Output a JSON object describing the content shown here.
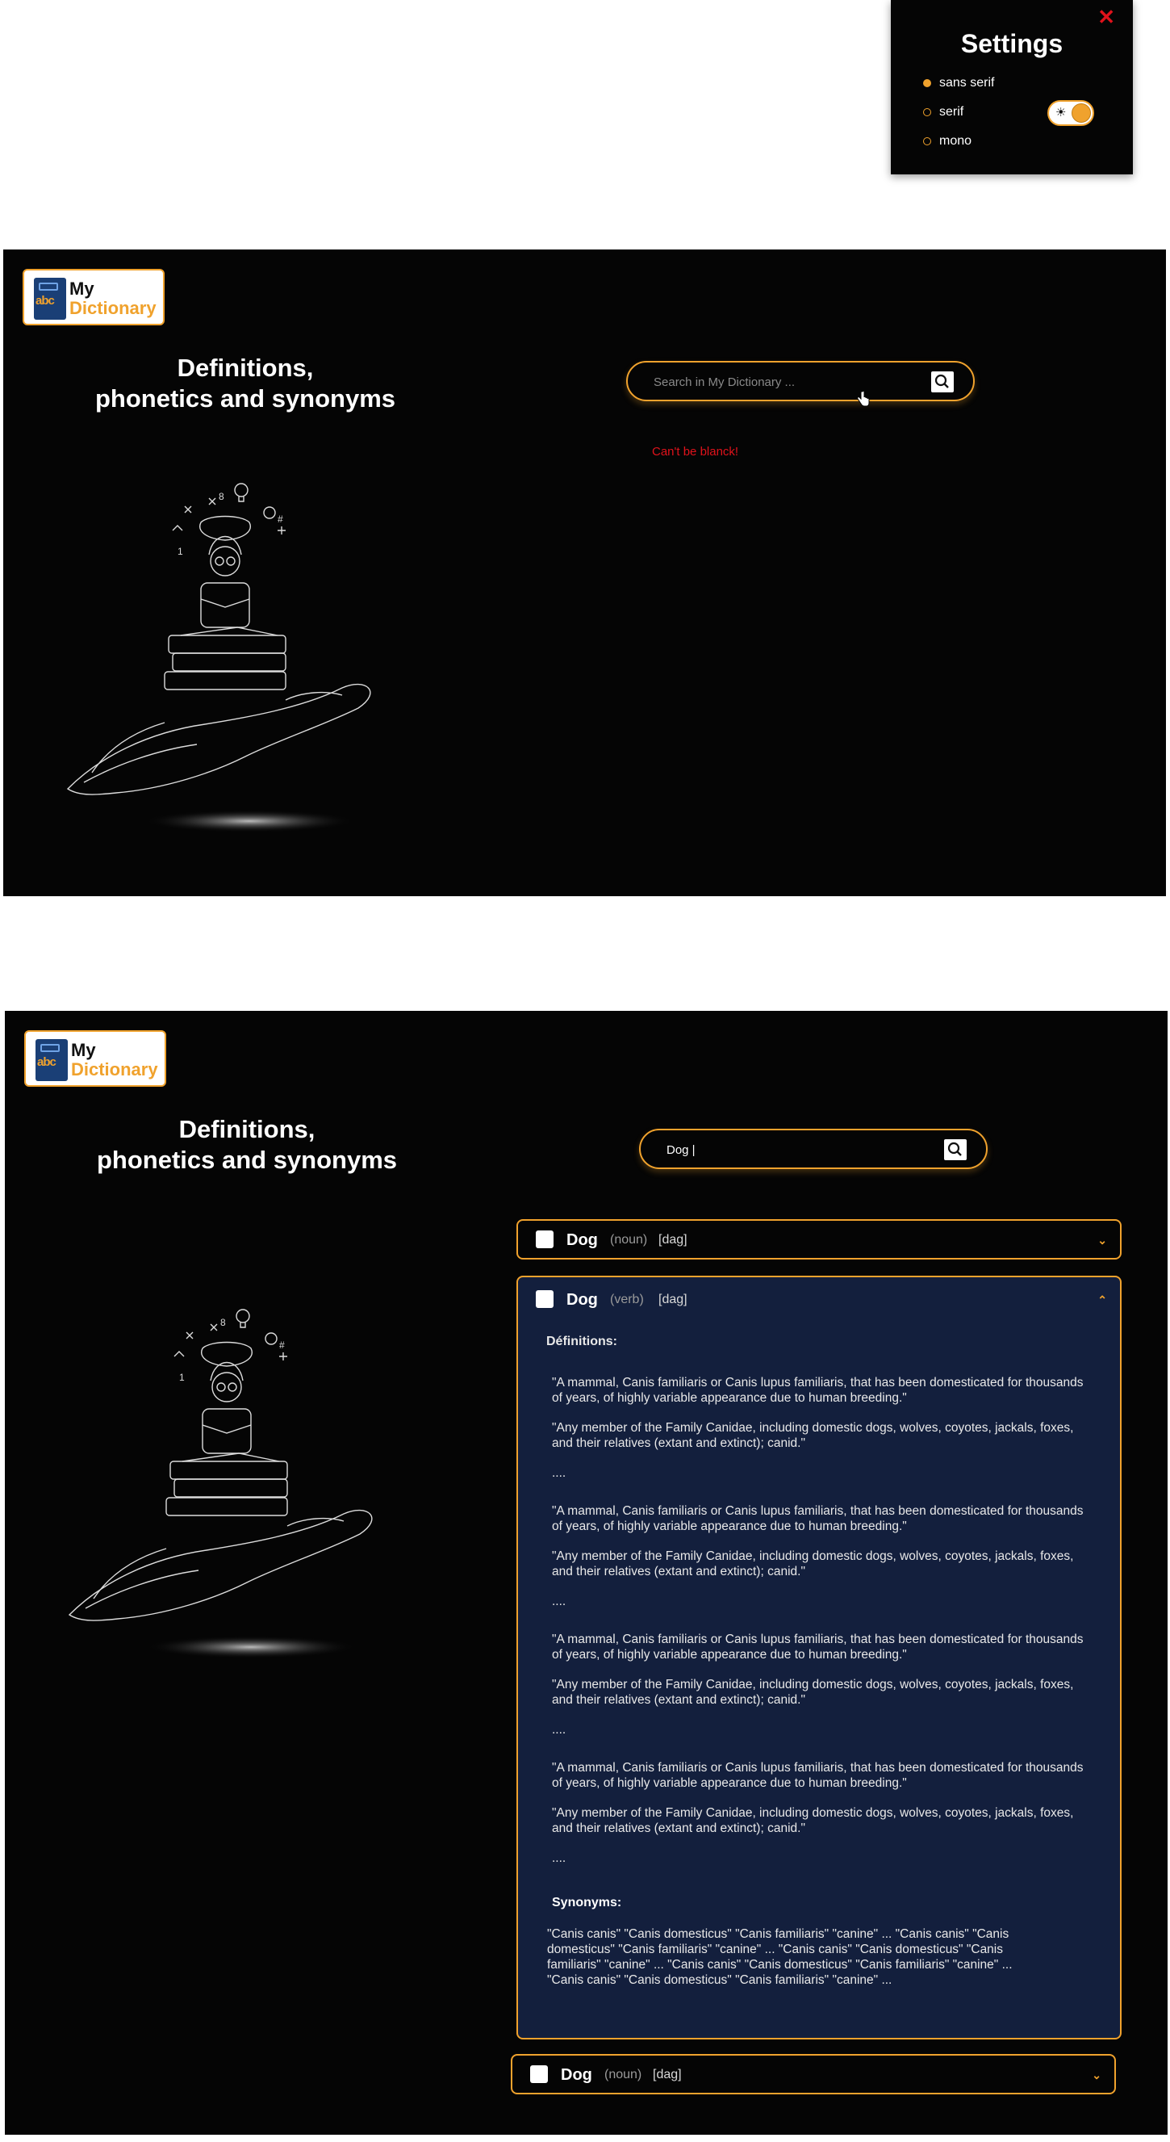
{
  "settings": {
    "title": "Settings",
    "close": "✕",
    "fonts": [
      {
        "label": "sans serif",
        "selected": true
      },
      {
        "label": "serif",
        "selected": false
      },
      {
        "label": "mono",
        "selected": false
      }
    ],
    "theme_toggle_icon": "sun-icon",
    "accent_color": "#f0a22d"
  },
  "app": {
    "logo_my": "My",
    "logo_dictionary": "Dictionary",
    "logo_abc": "abc",
    "hero_title_line1": "Definitions,",
    "hero_title_line2": "phonetics and synonyms"
  },
  "screen1": {
    "search_placeholder": "Search in My Dictionary ...",
    "search_value": "",
    "error": "Can't be blanck!"
  },
  "screen2": {
    "search_value": "Dog |",
    "entries": [
      {
        "word": "Dog",
        "pos": "(noun)",
        "phonetic": "[dag]",
        "expanded": false
      },
      {
        "word": "Dog",
        "pos": "(verb)",
        "phonetic": "[dag]",
        "expanded": true
      },
      {
        "word": "Dog",
        "pos": "(noun)",
        "phonetic": "[dag]",
        "expanded": false
      }
    ],
    "definitions_label": "Définitions:",
    "definitions": [
      "\"A mammal, Canis familiaris or Canis lupus familiaris, that has been domesticated for thousands of years, of highly variable appearance due to human breeding.\"",
      "\"Any member of the Family Canidae, including domestic dogs, wolves, coyotes, jackals, foxes, and their relatives (extant and extinct); canid.\"",
      "....",
      "\"A mammal, Canis familiaris or Canis lupus familiaris, that has been domesticated for thousands of years, of highly variable appearance due to human breeding.\"",
      "\"Any member of the Family Canidae, including domestic dogs, wolves, coyotes, jackals, foxes, and their relatives (extant and extinct); canid.\"",
      "....",
      "\"A mammal, Canis familiaris or Canis lupus familiaris, that has been domesticated for thousands of years, of highly variable appearance due to human breeding.\"",
      "\"Any member of the Family Canidae, including domestic dogs, wolves, coyotes, jackals, foxes, and their relatives (extant and extinct); canid.\"",
      "....",
      "\"A mammal, Canis familiaris or Canis lupus familiaris, that has been domesticated for thousands of years, of highly variable appearance due to human breeding.\"",
      "\"Any member of the Family Canidae, including domestic dogs, wolves, coyotes, jackals, foxes, and their relatives (extant and extinct); canid.\"",
      "...."
    ],
    "synonyms_label": "Synonyms:",
    "synonyms": "\"Canis canis\"  \"Canis domesticus\" \"Canis familiaris\" \"canine\" ... \"Canis canis\"  \"Canis domesticus\" \"Canis familiaris\" \"canine\" ... \"Canis canis\"  \"Canis domesticus\" \"Canis familiaris\" \"canine\" ... \"Canis canis\"  \"Canis domesticus\" \"Canis familiaris\" \"canine\" ... \"Canis canis\"  \"Canis domesticus\" \"Canis familiaris\" \"canine\" ..."
  }
}
